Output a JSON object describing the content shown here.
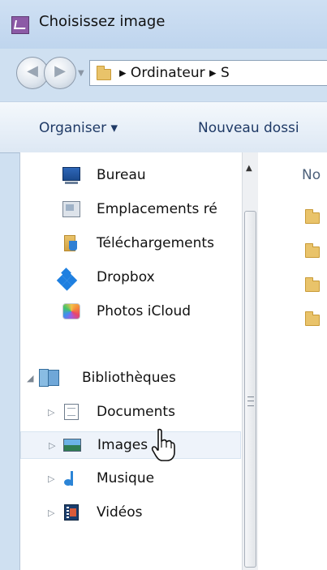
{
  "window": {
    "title": "Choisissez image"
  },
  "address": {
    "path": "▸ Ordinateur ▸ S"
  },
  "toolbar": {
    "organise_label": "Organiser ▾",
    "new_folder_label": "Nouveau dossi"
  },
  "left_nav": {
    "favorites": [
      {
        "label": "Bureau",
        "icon": "desktop-icon"
      },
      {
        "label": "Emplacements ré",
        "icon": "network-places-icon"
      },
      {
        "label": "Téléchargements",
        "icon": "downloads-folder-icon"
      },
      {
        "label": "Dropbox",
        "icon": "dropbox-icon"
      },
      {
        "label": "Photos iCloud",
        "icon": "icloud-photos-icon"
      }
    ],
    "libraries": {
      "label": "Bibliothèques",
      "items": [
        {
          "label": "Documents",
          "icon": "documents-icon"
        },
        {
          "label": "Images",
          "icon": "pictures-icon",
          "selected": true
        },
        {
          "label": "Musique",
          "icon": "music-icon"
        },
        {
          "label": "Vidéos",
          "icon": "videos-icon"
        }
      ]
    }
  },
  "right_pane": {
    "header": "No"
  },
  "colors": {
    "accent": "#1f3a66",
    "selection": "#eef3fa",
    "folder": "#e9c36a"
  }
}
